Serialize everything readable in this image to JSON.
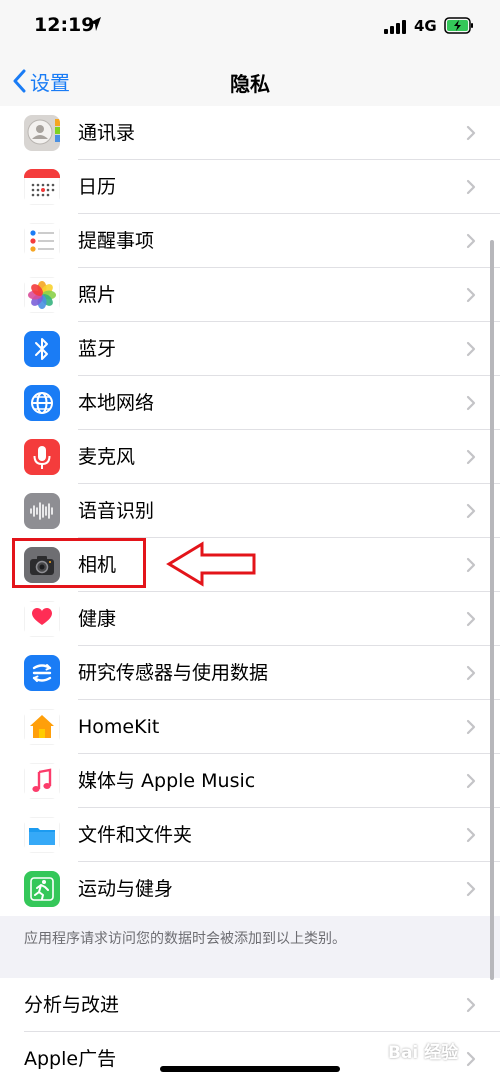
{
  "status": {
    "time": "12:19",
    "network": "4G"
  },
  "nav": {
    "back_label": "设置",
    "title": "隐私"
  },
  "items": [
    {
      "label": "通讯录"
    },
    {
      "label": "日历"
    },
    {
      "label": "提醒事项"
    },
    {
      "label": "照片"
    },
    {
      "label": "蓝牙"
    },
    {
      "label": "本地网络"
    },
    {
      "label": "麦克风"
    },
    {
      "label": "语音识别"
    },
    {
      "label": "相机"
    },
    {
      "label": "健康"
    },
    {
      "label": "研究传感器与使用数据"
    },
    {
      "label": "HomeKit"
    },
    {
      "label": "媒体与 Apple Music"
    },
    {
      "label": "文件和文件夹"
    },
    {
      "label": "运动与健身"
    }
  ],
  "footer_note": "应用程序请求访问您的数据时会被添加到以上类别。",
  "items2": [
    {
      "label": "分析与改进"
    },
    {
      "label": "Apple广告"
    }
  ],
  "watermark": "Bai 经验",
  "colors": {
    "accent": "#1a7cf5",
    "highlight": "#e3141a"
  }
}
